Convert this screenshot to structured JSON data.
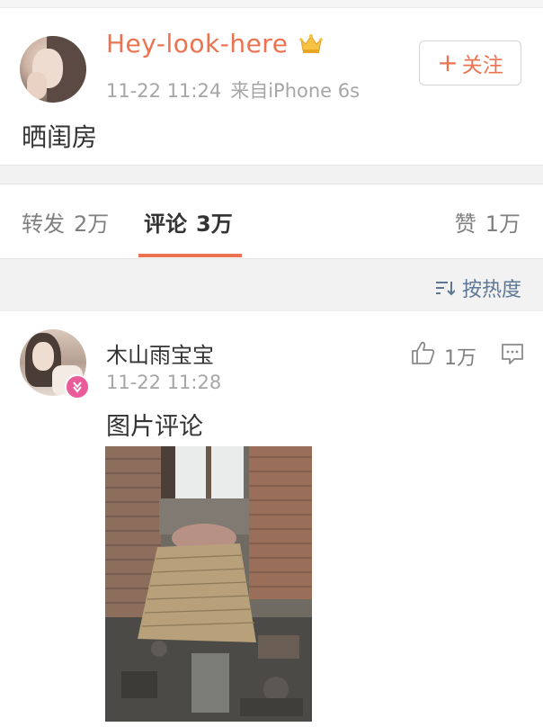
{
  "post": {
    "author": "Hey-look-here",
    "time": "11-22 11:24",
    "source": "来自iPhone 6s",
    "follow_label": "关注",
    "text": "晒闺房",
    "icons": {
      "avatar": "user-avatar",
      "crown": "crown-icon",
      "plus": "plus-icon"
    }
  },
  "tabs": {
    "repost": {
      "label": "转发",
      "count": "2万"
    },
    "comment": {
      "label": "评论",
      "count": "3万",
      "active": true
    },
    "like": {
      "label": "赞",
      "count": "1万"
    }
  },
  "sort": {
    "label": "按热度",
    "icon": "sort-icon"
  },
  "comment": {
    "user": "木山雨宝宝",
    "time": "11-22 11:28",
    "likes": "1万",
    "text": "图片评论",
    "icons": {
      "like": "thumbs-up-icon",
      "reply": "comment-bubble-icon",
      "badge": "verified-badge-icon"
    }
  },
  "colors": {
    "accent": "#eb7350",
    "link": "#5d7895",
    "muted": "#a6a6a6",
    "badge": "#ea5b9a"
  }
}
